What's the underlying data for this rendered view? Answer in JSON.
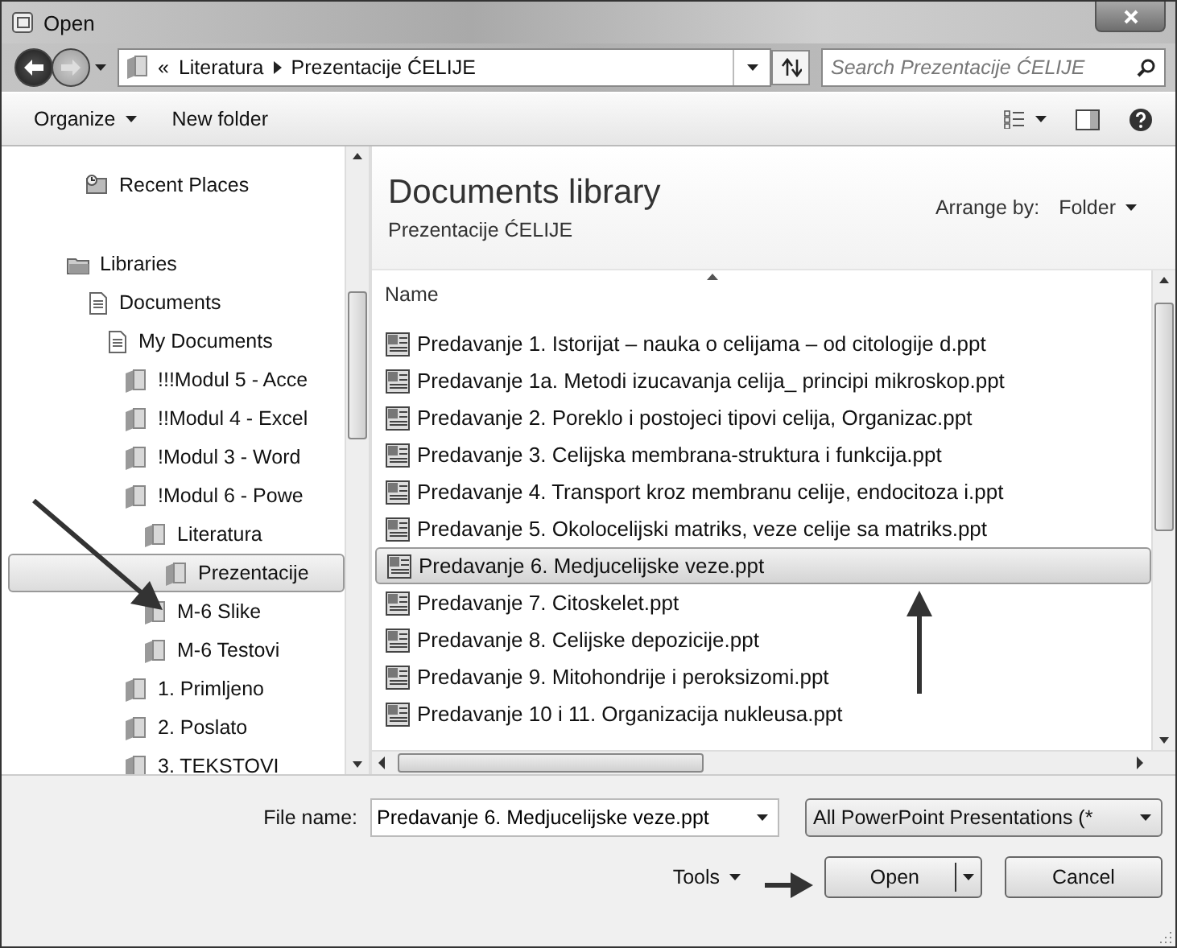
{
  "window": {
    "title": "Open"
  },
  "address": {
    "overflow": "«",
    "path": [
      "Literatura",
      "Prezentacije ĆELIJE"
    ]
  },
  "search": {
    "placeholder": "Search Prezentacije ĆELIJE"
  },
  "toolbar": [
    {
      "label": "Organize",
      "dropdown": true
    },
    {
      "label": "New folder",
      "dropdown": false
    }
  ],
  "navigation": [
    {
      "label": "Recent Places",
      "kind": "recent",
      "selected": false
    },
    {
      "label": "Libraries",
      "kind": "library",
      "selected": false,
      "children": [
        {
          "label": "Documents",
          "kind": "documents",
          "selected": false,
          "children": [
            {
              "label": "My Documents",
              "kind": "documents",
              "selected": false,
              "children": [
                {
                  "label": "!!!Modul 5 - Acce",
                  "kind": "folder",
                  "selected": false
                },
                {
                  "label": "!!Modul 4 - Excel",
                  "kind": "folder",
                  "selected": false
                },
                {
                  "label": "!Modul 3 - Word",
                  "kind": "folder",
                  "selected": false
                },
                {
                  "label": "!Modul 6 - Powe",
                  "kind": "folder",
                  "selected": false,
                  "children": [
                    {
                      "label": "Literatura",
                      "kind": "folder",
                      "selected": false,
                      "children": [
                        {
                          "label": "Prezentacije",
                          "kind": "folder",
                          "selected": true
                        }
                      ]
                    },
                    {
                      "label": "M-6 Slike",
                      "kind": "folder",
                      "selected": false
                    },
                    {
                      "label": "M-6 Testovi",
                      "kind": "folder",
                      "selected": false
                    }
                  ]
                },
                {
                  "label": "1. Primljeno",
                  "kind": "folder",
                  "selected": false
                },
                {
                  "label": "2. Poslato",
                  "kind": "folder",
                  "selected": false
                },
                {
                  "label": "3. TEKSTOVI",
                  "kind": "folder",
                  "selected": false
                }
              ]
            }
          ]
        }
      ]
    }
  ],
  "library": {
    "title": "Documents library",
    "subtitle": "Prezentacije ĆELIJE",
    "arrange_label": "Arrange by:",
    "arrange_value": "Folder"
  },
  "columns": [
    "Name"
  ],
  "files": [
    {
      "name": "Predavanje 1. Istorijat – nauka o celijama – od citologije d.ppt",
      "selected": false
    },
    {
      "name": "Predavanje 1a.   Metodi izucavanja celija_ principi mikroskop.ppt",
      "selected": false
    },
    {
      "name": "Predavanje 2.  Poreklo i postojeci tipovi celija, Organizac.ppt",
      "selected": false
    },
    {
      "name": "Predavanje 3. Celijska membrana-struktura i funkcija.ppt",
      "selected": false
    },
    {
      "name": "Predavanje 4. Transport kroz membranu celije, endocitoza i.ppt",
      "selected": false
    },
    {
      "name": "Predavanje 5. Okolocelijski matriks, veze celije sa matriks.ppt",
      "selected": false
    },
    {
      "name": "Predavanje 6. Medjucelijske veze.ppt",
      "selected": true
    },
    {
      "name": "Predavanje 7. Citoskelet.ppt",
      "selected": false
    },
    {
      "name": "Predavanje 8. Celijske depozicije.ppt",
      "selected": false
    },
    {
      "name": "Predavanje 9. Mitohondrije i peroksizomi.ppt",
      "selected": false
    },
    {
      "name": "Predavanje 10 i 11. Organizacija nukleusa.ppt",
      "selected": false
    }
  ],
  "file_name": {
    "label": "File name:",
    "value": "Predavanje 6. Medjucelijske veze.ppt"
  },
  "file_type": "All PowerPoint Presentations (*",
  "tools": "Tools",
  "buttons": [
    {
      "label": "Open",
      "kind": "split"
    },
    {
      "label": "Cancel",
      "kind": "plain"
    }
  ]
}
